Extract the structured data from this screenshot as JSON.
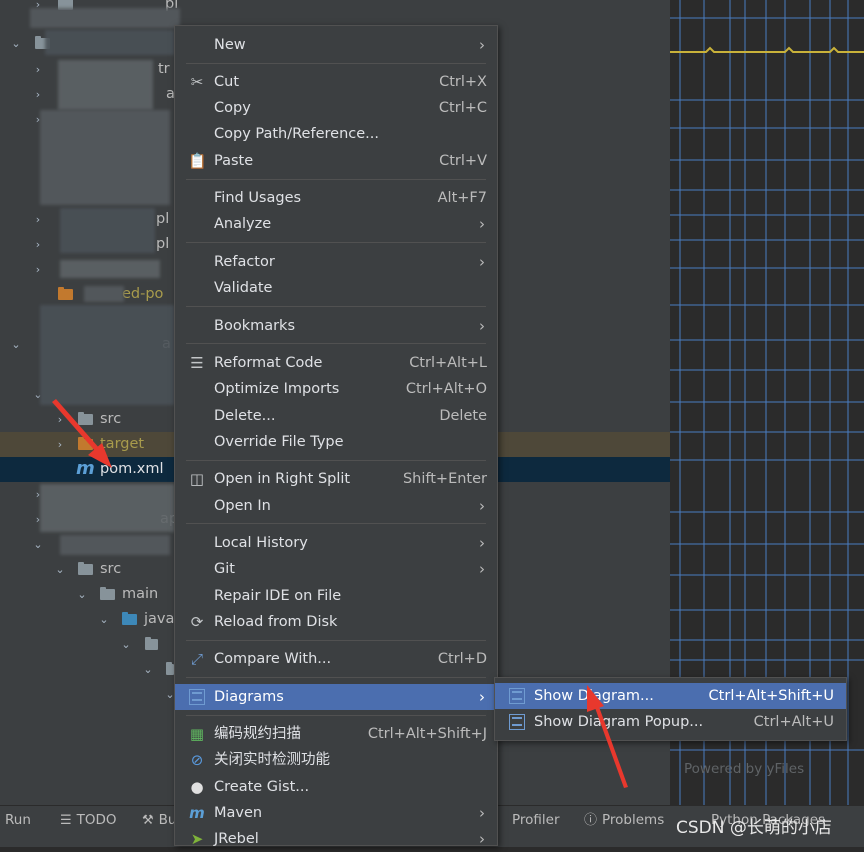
{
  "tree": {
    "rows": [
      {
        "label": "src",
        "type": "folder-grey"
      },
      {
        "label": "target",
        "type": "folder-orange"
      },
      {
        "label": "pom.xml",
        "type": "maven-file"
      },
      {
        "label": "src",
        "type": "folder-grey"
      },
      {
        "label": "main",
        "type": "folder-grey"
      },
      {
        "label": "java",
        "type": "folder-blue"
      }
    ],
    "partial_texts": {
      "ignored_pom": "ed-po",
      "fragments": [
        "pi",
        "tr",
        "a",
        "pl",
        "pl",
        "a",
        "ap"
      ]
    }
  },
  "context_menu": {
    "items": [
      {
        "label": "New",
        "shortcut": "",
        "submenu": true,
        "icon": ""
      },
      {
        "label": "Cut",
        "shortcut": "Ctrl+X",
        "submenu": false,
        "icon": "scissors-icon"
      },
      {
        "label": "Copy",
        "shortcut": "Ctrl+C",
        "submenu": false,
        "icon": ""
      },
      {
        "label": "Copy Path/Reference...",
        "shortcut": "",
        "submenu": false,
        "icon": ""
      },
      {
        "label": "Paste",
        "shortcut": "Ctrl+V",
        "submenu": false,
        "icon": "clipboard-icon"
      },
      {
        "label": "Find Usages",
        "shortcut": "Alt+F7",
        "submenu": false,
        "icon": ""
      },
      {
        "label": "Analyze",
        "shortcut": "",
        "submenu": true,
        "icon": ""
      },
      {
        "label": "Refactor",
        "shortcut": "",
        "submenu": true,
        "icon": ""
      },
      {
        "label": "Validate",
        "shortcut": "",
        "submenu": false,
        "icon": ""
      },
      {
        "label": "Bookmarks",
        "shortcut": "",
        "submenu": true,
        "icon": ""
      },
      {
        "label": "Reformat Code",
        "shortcut": "Ctrl+Alt+L",
        "submenu": false,
        "icon": "reformat-icon"
      },
      {
        "label": "Optimize Imports",
        "shortcut": "Ctrl+Alt+O",
        "submenu": false,
        "icon": ""
      },
      {
        "label": "Delete...",
        "shortcut": "Delete",
        "submenu": false,
        "icon": ""
      },
      {
        "label": "Override File Type",
        "shortcut": "",
        "submenu": false,
        "icon": ""
      },
      {
        "label": "Open in Right Split",
        "shortcut": "Shift+Enter",
        "submenu": false,
        "icon": "split-icon"
      },
      {
        "label": "Open In",
        "shortcut": "",
        "submenu": true,
        "icon": ""
      },
      {
        "label": "Local History",
        "shortcut": "",
        "submenu": true,
        "icon": ""
      },
      {
        "label": "Git",
        "shortcut": "",
        "submenu": true,
        "icon": ""
      },
      {
        "label": "Repair IDE on File",
        "shortcut": "",
        "submenu": false,
        "icon": ""
      },
      {
        "label": "Reload from Disk",
        "shortcut": "",
        "submenu": false,
        "icon": "reload-icon"
      },
      {
        "label": "Compare With...",
        "shortcut": "Ctrl+D",
        "submenu": false,
        "icon": "compare-icon"
      },
      {
        "label": "Diagrams",
        "shortcut": "",
        "submenu": true,
        "icon": "diagram-icon"
      },
      {
        "label": "编码规约扫描",
        "shortcut": "Ctrl+Alt+Shift+J",
        "submenu": false,
        "icon": "scan-icon"
      },
      {
        "label": "关闭实时检测功能",
        "shortcut": "",
        "submenu": false,
        "icon": "disable-icon"
      },
      {
        "label": "Create Gist...",
        "shortcut": "",
        "submenu": false,
        "icon": "github-icon"
      },
      {
        "label": "Maven",
        "shortcut": "",
        "submenu": true,
        "icon": "maven-icon"
      },
      {
        "label": "JRebel",
        "shortcut": "",
        "submenu": true,
        "icon": "jrebel-icon"
      }
    ]
  },
  "diagrams_submenu": {
    "items": [
      {
        "label": "Show Diagram...",
        "shortcut": "Ctrl+Alt+Shift+U"
      },
      {
        "label": "Show Diagram Popup...",
        "shortcut": "Ctrl+Alt+U"
      }
    ]
  },
  "diagram_area": {
    "powered_by": "Powered by yFiles"
  },
  "bottom_bar": {
    "run": "Run",
    "todo": "TODO",
    "build_partial": "Bu",
    "profiler": "Profiler",
    "problems": "Problems",
    "python_packages": "Python Packages"
  },
  "watermark": "CSDN @长萌的小店",
  "colors": {
    "menu_bg": "#3c3f41",
    "highlight": "#4b6eaf",
    "selected_row": "#0d293e",
    "arrow": "#e8382d"
  }
}
